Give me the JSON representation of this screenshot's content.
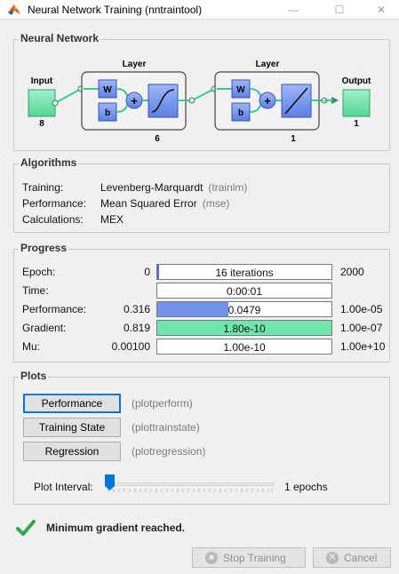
{
  "window": {
    "title": "Neural Network Training (nntraintool)",
    "minimize_glyph": "—",
    "maximize_glyph": "☐",
    "close_glyph": "✕"
  },
  "network": {
    "section_title": "Neural Network",
    "input_label": "Input",
    "input_size": "8",
    "output_label": "Output",
    "output_size": "1",
    "hidden_layer": {
      "title": "Layer",
      "w": "W",
      "b": "b",
      "plus": "+",
      "size": "6",
      "transfer": "tansig"
    },
    "output_layer": {
      "title": "Layer",
      "w": "W",
      "b": "b",
      "plus": "+",
      "size": "1",
      "transfer": "purelin"
    },
    "colors": {
      "io_box": "#66e0a3",
      "weight_box": "#6f8ff0",
      "layer_bg": "#f2f2f2",
      "connector": "#3cc98d"
    }
  },
  "algorithms": {
    "section_title": "Algorithms",
    "rows": [
      {
        "label": "Training:",
        "value": "Levenberg-Marquardt",
        "function": "(trainlm)"
      },
      {
        "label": "Performance:",
        "value": "Mean Squared Error",
        "function": "(mse)"
      },
      {
        "label": "Calculations:",
        "value": "MEX",
        "function": ""
      }
    ]
  },
  "progress": {
    "section_title": "Progress",
    "rows": [
      {
        "label": "Epoch:",
        "start": "0",
        "bar_text": "16 iterations",
        "end": "2000",
        "fill": 0.008,
        "fill_color": "#4a6fe0"
      },
      {
        "label": "Time:",
        "start": "",
        "bar_text": "0:00:01",
        "end": "",
        "fill": 0,
        "fill_color": "#4a6fe0"
      },
      {
        "label": "Performance:",
        "start": "0.316",
        "bar_text": "0.0479",
        "end": "1.00e-05",
        "fill": 0.41,
        "fill_color": "#7393e8"
      },
      {
        "label": "Gradient:",
        "start": "0.819",
        "bar_text": "1.80e-10",
        "end": "1.00e-07",
        "fill": 1.0,
        "fill_color": "#6fe6ad"
      },
      {
        "label": "Mu:",
        "start": "0.00100",
        "bar_text": "1.00e-10",
        "end": "1.00e+10",
        "fill": 0,
        "fill_color": "#4a6fe0"
      }
    ]
  },
  "plots": {
    "section_title": "Plots",
    "buttons": [
      {
        "label": "Performance",
        "function": "(plotperform)"
      },
      {
        "label": "Training State",
        "function": "(plottrainstate)"
      },
      {
        "label": "Regression",
        "function": "(plotregression)"
      }
    ],
    "interval_label": "Plot Interval:",
    "interval_value": "1 epochs",
    "slider_fraction": 0.0
  },
  "status": {
    "message": "Minimum gradient reached.",
    "icon": "checkmark-icon",
    "color": "#2ea84a"
  },
  "footer": {
    "stop_label": "Stop Training",
    "cancel_label": "Cancel",
    "stop_icon": "stop-icon",
    "cancel_icon": "cancel-icon"
  }
}
